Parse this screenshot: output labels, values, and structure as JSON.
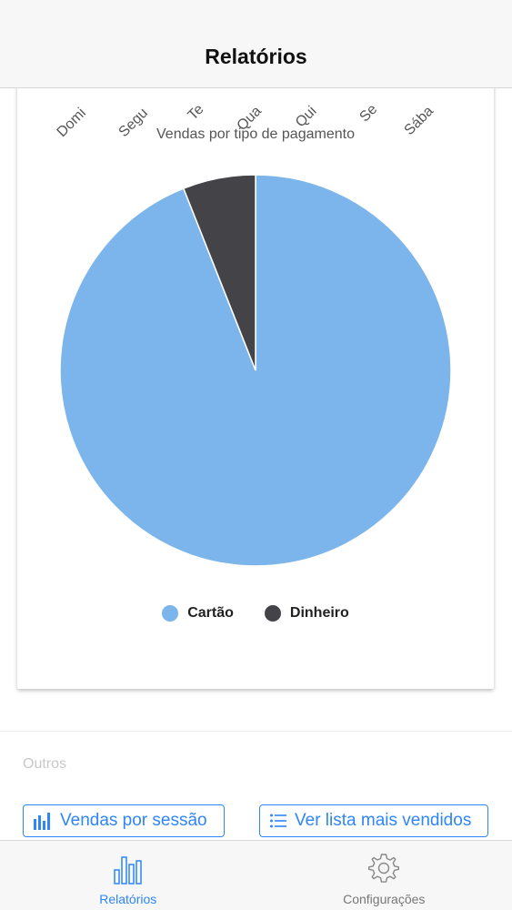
{
  "header": {
    "title": "Relatórios"
  },
  "weekday_labels": [
    "Domi",
    "Segu",
    "Te",
    "Qua",
    "Qui",
    "Se",
    "Sába"
  ],
  "chart_data": {
    "type": "pie",
    "title": "Vendas por tipo de pagamento",
    "slices": [
      {
        "label": "Cartão",
        "value": 94,
        "color": "#7cb5ec"
      },
      {
        "label": "Dinheiro",
        "value": 6,
        "color": "#434348"
      }
    ],
    "legend": "bottom-center"
  },
  "others": {
    "section_label": "Outros"
  },
  "buttons": {
    "sales_by_session": "Vendas por sessão",
    "best_sellers_list": "Ver lista mais vendidos"
  },
  "tabbar": {
    "tabs": [
      {
        "label": "Relatórios",
        "icon": "bar-chart-icon",
        "active": true
      },
      {
        "label": "Configurações",
        "icon": "gear-icon",
        "active": false
      }
    ]
  },
  "colors": {
    "accent": "#2f86f6"
  }
}
